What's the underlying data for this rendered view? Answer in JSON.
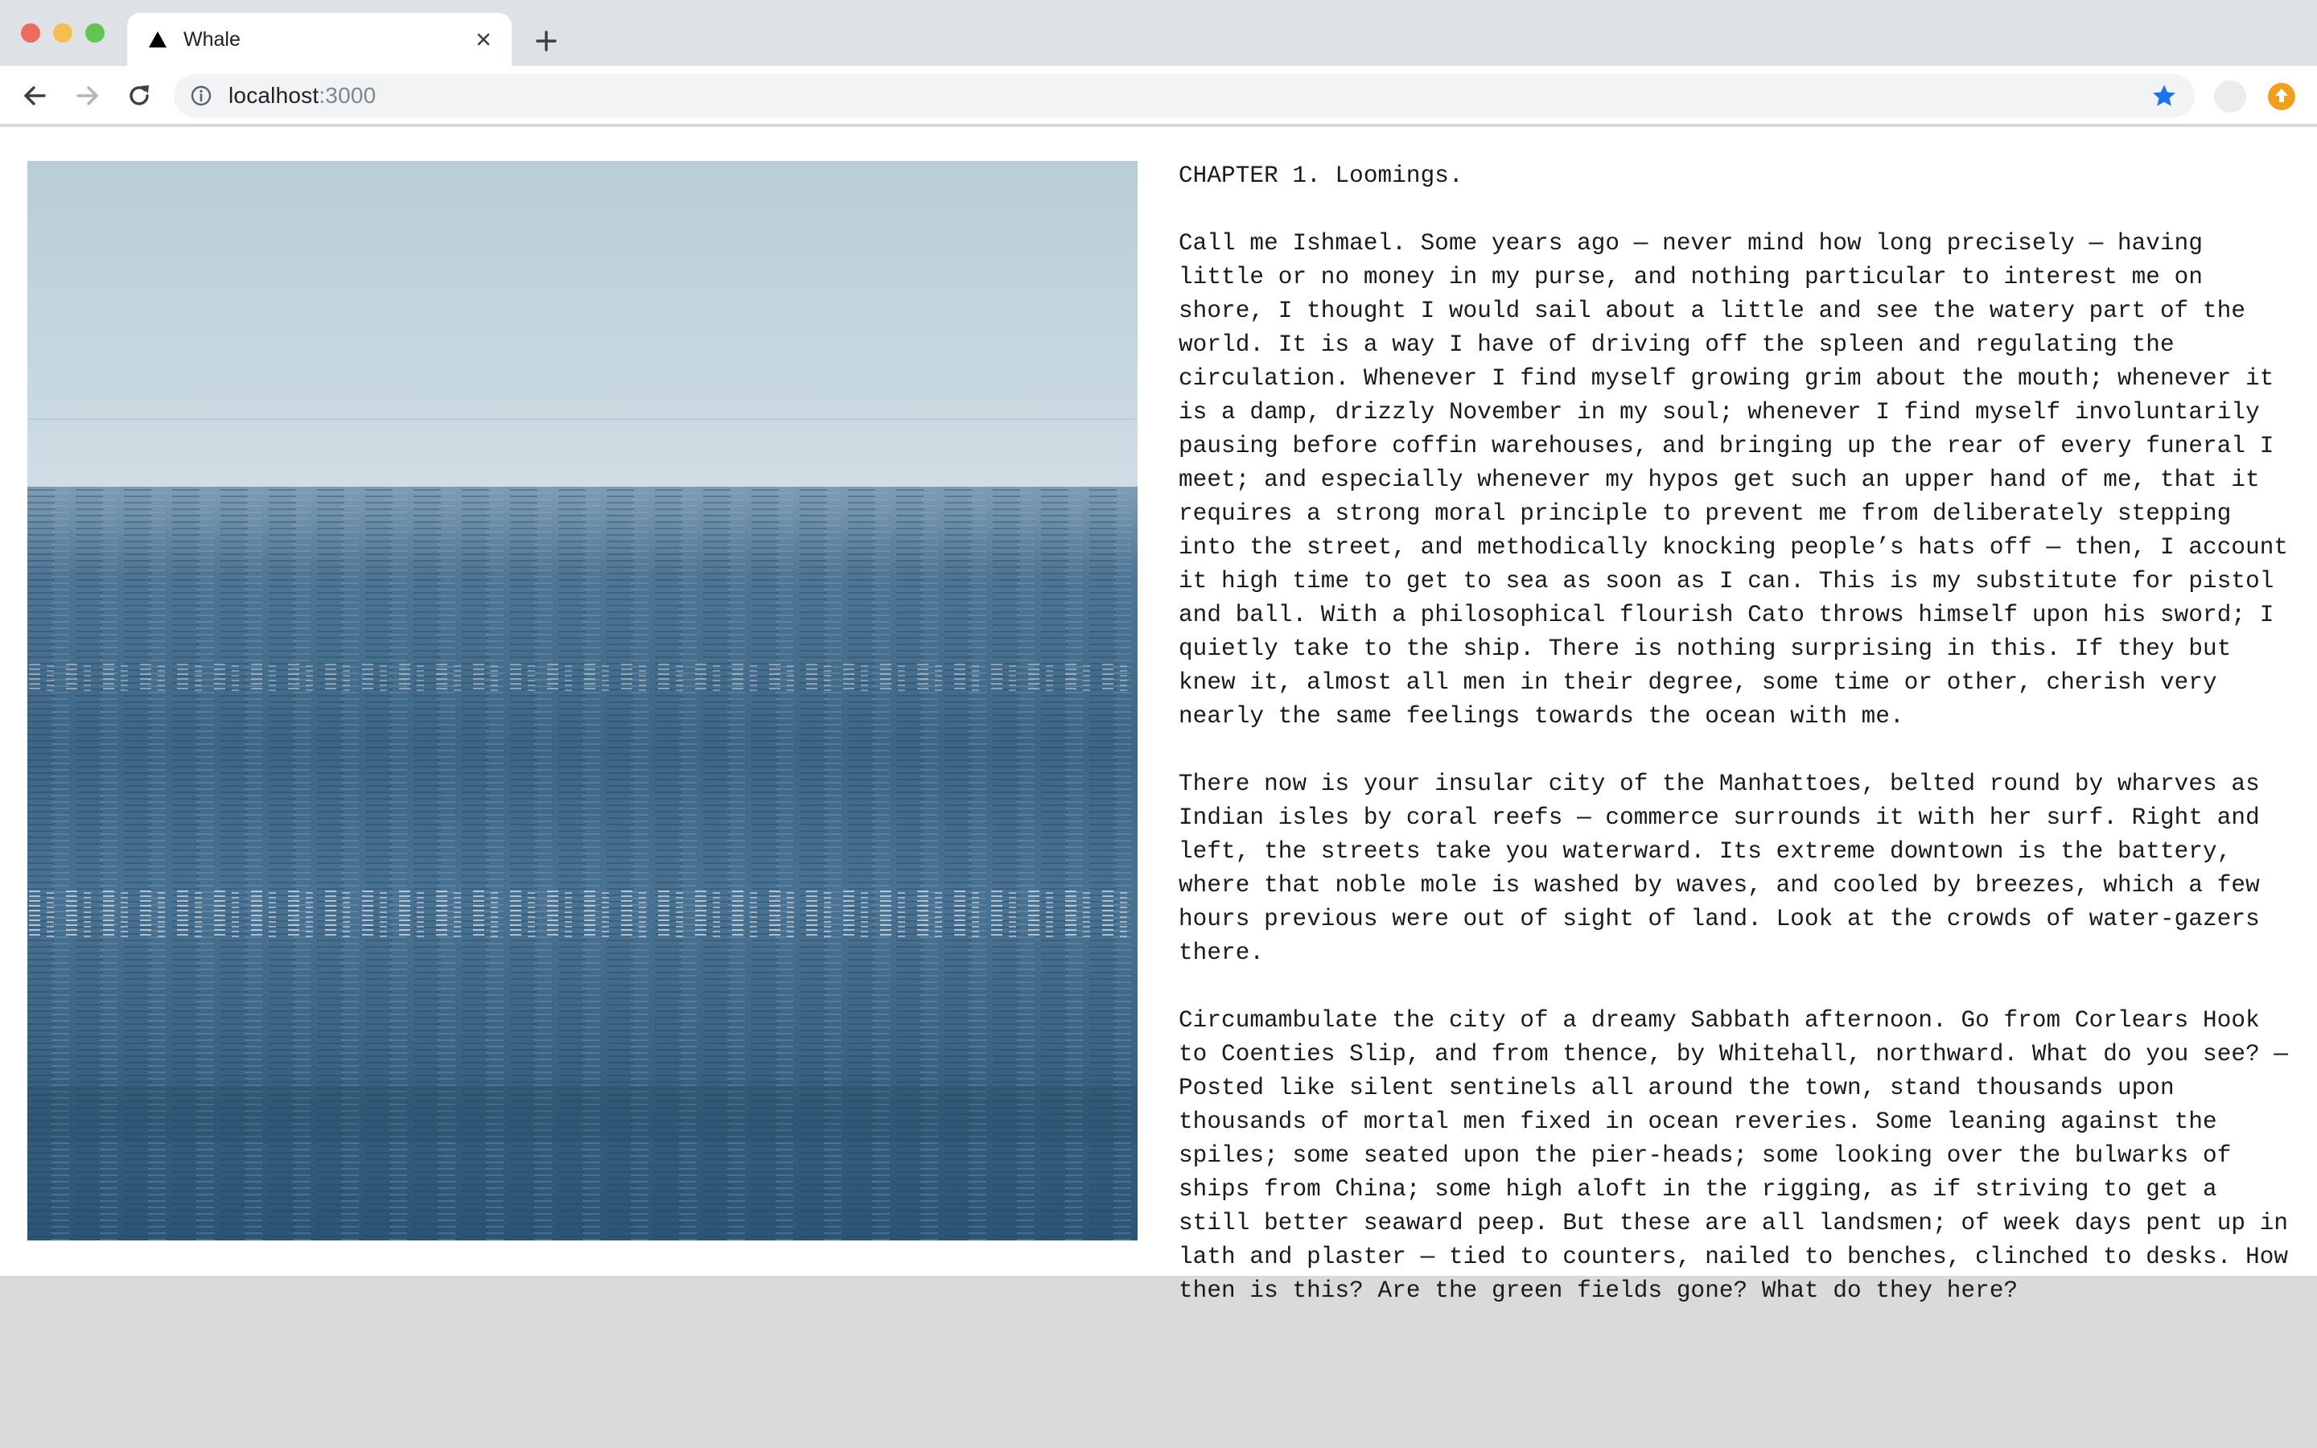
{
  "browser": {
    "tab": {
      "title": "Whale",
      "favicon": "triangle-icon"
    },
    "address": {
      "host": "localhost",
      "port": ":3000"
    },
    "icons": {
      "back": "arrow-left-icon",
      "forward": "arrow-right-icon",
      "reload": "reload-icon",
      "info": "info-icon",
      "bookmark": "star-icon",
      "extension": "upload-badge-icon"
    },
    "colors": {
      "star": "#1a73e8",
      "extension": "#f0a020"
    }
  },
  "article": {
    "chapter": "CHAPTER 1. Loomings.",
    "paragraphs": [
      "Call me Ishmael. Some years ago — never mind how long precisely — having little or no money in my purse, and nothing particular to interest me on shore, I thought I would sail about a little and see the watery part of the world. It is a way I have of driving off the spleen and regulating the circulation. Whenever I find myself growing grim about the mouth; whenever it is a damp, drizzly November in my soul; whenever I find myself involuntarily pausing before coffin warehouses, and bringing up the rear of every funeral I meet; and especially whenever my hypos get such an upper hand of me, that it requires a strong moral principle to prevent me from deliberately stepping into the street, and methodically knocking people’s hats off — then, I account it high time to get to sea as soon as I can. This is my substitute for pistol and ball. With a philosophical flourish Cato throws himself upon his sword; I quietly take to the ship. There is nothing surprising in this. If they but knew it, almost all men in their degree, some time or other, cherish very nearly the same feelings towards the ocean with me.",
      "There now is your insular city of the Manhattoes, belted round by wharves as Indian isles by coral reefs — commerce surrounds it with her surf. Right and left, the streets take you waterward. Its extreme downtown is the battery, where that noble mole is washed by waves, and cooled by breezes, which a few hours previous were out of sight of land. Look at the crowds of water-gazers there.",
      "Circumambulate the city of a dreamy Sabbath afternoon. Go from Corlears Hook to Coenties Slip, and from thence, by Whitehall, northward. What do you see? — Posted like silent sentinels all around the town, stand thousands upon thousands of mortal men fixed in ocean reveries. Some leaning against the spiles; some seated upon the pier-heads; some looking over the bulwarks of ships from China; some high aloft in the rigging, as if striving to get a still better seaward peep. But these are all landsmen; of week days pent up in lath and plaster — tied to counters, nailed to benches, clinched to desks. How then is this? Are the green fields gone? What do they here?"
    ]
  }
}
